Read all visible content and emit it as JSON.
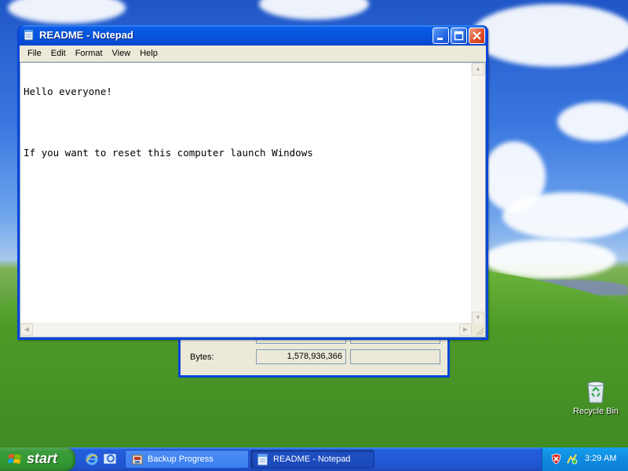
{
  "desktop": {
    "recycle_bin_label": "Recycle Bin"
  },
  "notepad": {
    "title": "README - Notepad",
    "menu": [
      "File",
      "Edit",
      "Format",
      "View",
      "Help"
    ],
    "content_lines": [
      "Hello everyone!",
      "",
      "If you want to reset this computer launch Windows"
    ]
  },
  "backup_window": {
    "bytes_label": "Bytes:",
    "bytes_value": "1,578,936,366"
  },
  "taskbar": {
    "start_label": "start",
    "tasks": [
      {
        "label": "Backup Progress",
        "icon": "backup-icon",
        "active": false
      },
      {
        "label": "README - Notepad",
        "icon": "notepad-icon",
        "active": true
      }
    ],
    "clock": "3:29 AM"
  },
  "colors": {
    "titlebar_blue": "#0a5ce6",
    "taskbar_blue": "#245edb",
    "start_green": "#339933",
    "close_red": "#e0512c"
  }
}
